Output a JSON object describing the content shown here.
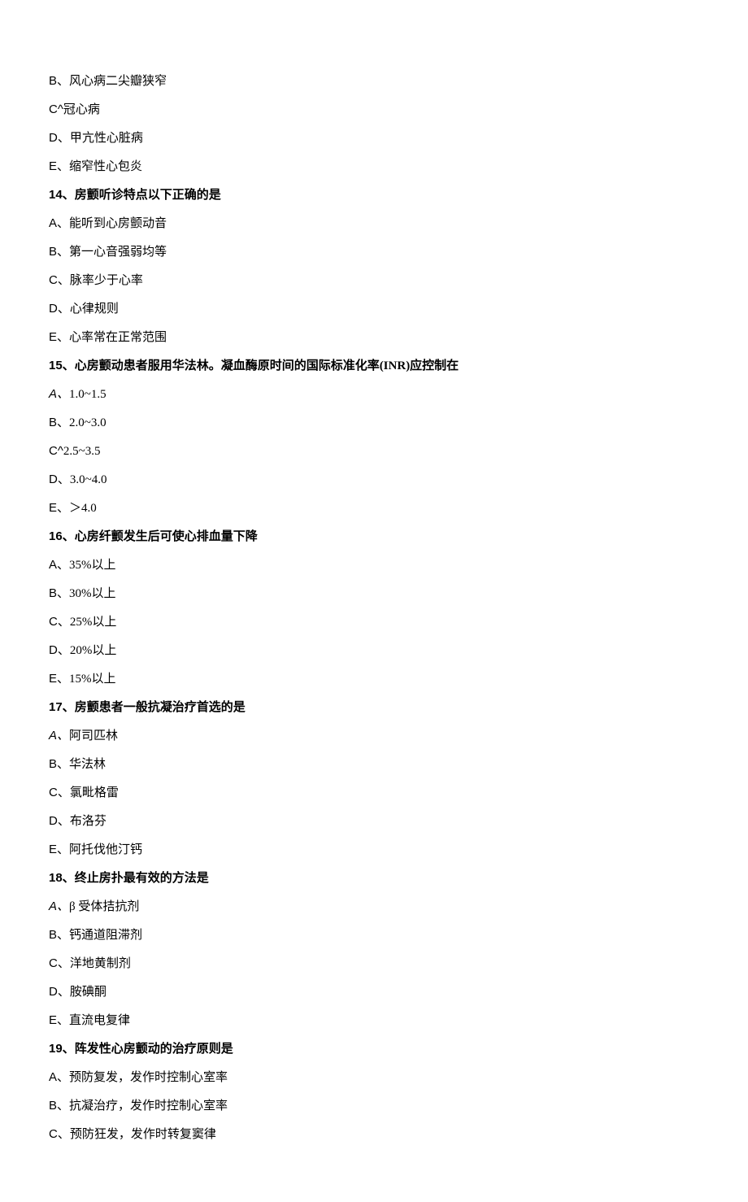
{
  "lines": [
    {
      "type": "option",
      "letter": "B、",
      "text": "风心病二尖瓣狭窄"
    },
    {
      "type": "option",
      "letter": "C^",
      "text": "冠心病"
    },
    {
      "type": "option",
      "letter": "D、",
      "text": "甲亢性心脏病"
    },
    {
      "type": "option",
      "letter": "E、",
      "text": "缩窄性心包炎"
    },
    {
      "type": "question",
      "num": "14、",
      "text": "房颤听诊特点以下正确的是"
    },
    {
      "type": "option",
      "letter": "A、",
      "text": "能听到心房颤动音"
    },
    {
      "type": "option",
      "letter": "B、",
      "text": "第一心音强弱均等"
    },
    {
      "type": "option",
      "letter": "C、",
      "text": "脉率少于心率"
    },
    {
      "type": "option",
      "letter": "D、",
      "text": "心律规则"
    },
    {
      "type": "option",
      "letter": "E、",
      "text": "心率常在正常范围"
    },
    {
      "type": "question",
      "num": "15、",
      "text": "心房颤动患者服用华法林。凝血酶原时间的国际标准化率(INR)应控制在"
    },
    {
      "type": "option_ital",
      "letter": "A、",
      "text": "1.0~1.5"
    },
    {
      "type": "option",
      "letter": "B、",
      "text": "2.0~3.0"
    },
    {
      "type": "option",
      "letter": "C^",
      "text": "2.5~3.5"
    },
    {
      "type": "option",
      "letter": "D、",
      "text": "3.0~4.0"
    },
    {
      "type": "option",
      "letter": "E、",
      "text": "＞4.0"
    },
    {
      "type": "question",
      "num": "16、",
      "text": "心房纤颤发生后可使心排血量下降"
    },
    {
      "type": "option",
      "letter": "A、",
      "text": "35%以上"
    },
    {
      "type": "option",
      "letter": "B、",
      "text": "30%以上"
    },
    {
      "type": "option",
      "letter": "C、",
      "text": "25%以上"
    },
    {
      "type": "option",
      "letter": "D、",
      "text": "20%以上"
    },
    {
      "type": "option",
      "letter": "E、",
      "text": "15%以上"
    },
    {
      "type": "question",
      "num": "17、",
      "text": "房颤患者一般抗凝治疗首选的是"
    },
    {
      "type": "option_ital",
      "letter": "A、",
      "text": "阿司匹林"
    },
    {
      "type": "option",
      "letter": "B、",
      "text": "华法林"
    },
    {
      "type": "option",
      "letter": "C、",
      "text": "氯毗格雷"
    },
    {
      "type": "option",
      "letter": "D、",
      "text": "布洛芬"
    },
    {
      "type": "option",
      "letter": "E、",
      "text": "阿托伐他汀钙"
    },
    {
      "type": "question",
      "num": "18、",
      "text": "终止房扑最有效的方法是"
    },
    {
      "type": "option_ital",
      "letter": "A、",
      "text": "β 受体拮抗剂"
    },
    {
      "type": "option",
      "letter": "B、",
      "text": "钙通道阻滞剂"
    },
    {
      "type": "option",
      "letter": "C、",
      "text": "洋地黄制剂"
    },
    {
      "type": "option",
      "letter": "D、",
      "text": "胺碘酮"
    },
    {
      "type": "option",
      "letter": "E、",
      "text": "直流电复律"
    },
    {
      "type": "question",
      "num": "19、",
      "text": "阵发性心房颤动的治疗原则是"
    },
    {
      "type": "option",
      "letter": "A、",
      "text": "预防复发，发作时控制心室率"
    },
    {
      "type": "option",
      "letter": "B、",
      "text": "抗凝治疗，发作时控制心室率"
    },
    {
      "type": "option",
      "letter": "C、",
      "text": "预防狂发，发作时转复窦律"
    }
  ]
}
